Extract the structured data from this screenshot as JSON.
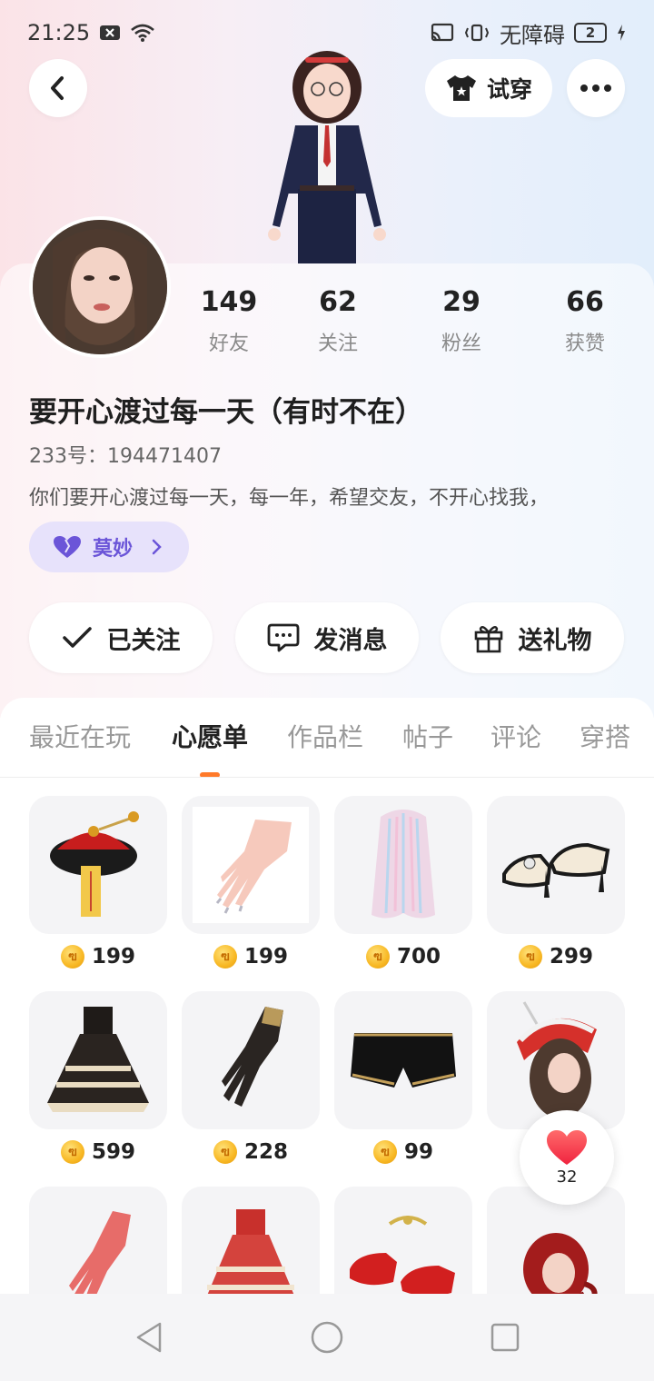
{
  "status_bar": {
    "time": "21:25",
    "accessibility_label": "无障碍",
    "battery_level": "2"
  },
  "header": {
    "back_icon": "chevron-left-icon",
    "tryon_label": "试穿",
    "more_icon": "more-horizontal-icon"
  },
  "profile": {
    "stats": [
      {
        "value": "149",
        "label": "好友"
      },
      {
        "value": "62",
        "label": "关注"
      },
      {
        "value": "29",
        "label": "粉丝"
      },
      {
        "value": "66",
        "label": "获赞"
      }
    ],
    "nickname": "要开心渡过每一天（有时不在）",
    "uid_text": "233号：194471407",
    "bio": "你们要开心渡过每一天，每一年，希望交友，不开心找我，",
    "tag_label": "莫妙",
    "tag_color": "#6b55d8"
  },
  "actions": [
    {
      "label": "已关注",
      "icon": "check-icon"
    },
    {
      "label": "发消息",
      "icon": "message-icon"
    },
    {
      "label": "送礼物",
      "icon": "gift-icon"
    }
  ],
  "tabs": [
    {
      "label": "最近在玩",
      "active": false
    },
    {
      "label": "心愿单",
      "active": true
    },
    {
      "label": "作品栏",
      "active": false
    },
    {
      "label": "帖子",
      "active": false
    },
    {
      "label": "评论",
      "active": false
    },
    {
      "label": "穿搭",
      "active": false
    }
  ],
  "accent_color": "#ff7a2a",
  "wishlist": [
    {
      "name": "hat-item",
      "price": "199"
    },
    {
      "name": "nails-item",
      "price": "199"
    },
    {
      "name": "hair-item",
      "price": "700"
    },
    {
      "name": "shoes-item",
      "price": "299"
    },
    {
      "name": "dress-item",
      "price": "599"
    },
    {
      "name": "glove-item",
      "price": "228"
    },
    {
      "name": "shorts-item",
      "price": "99"
    },
    {
      "name": "bonnet-item",
      "price": ""
    },
    {
      "name": "lace-glove-item",
      "price": ""
    },
    {
      "name": "red-dress-item",
      "price": ""
    },
    {
      "name": "red-shoes-item",
      "price": ""
    },
    {
      "name": "red-hair-item",
      "price": ""
    }
  ],
  "like_fab": {
    "count": "32"
  }
}
